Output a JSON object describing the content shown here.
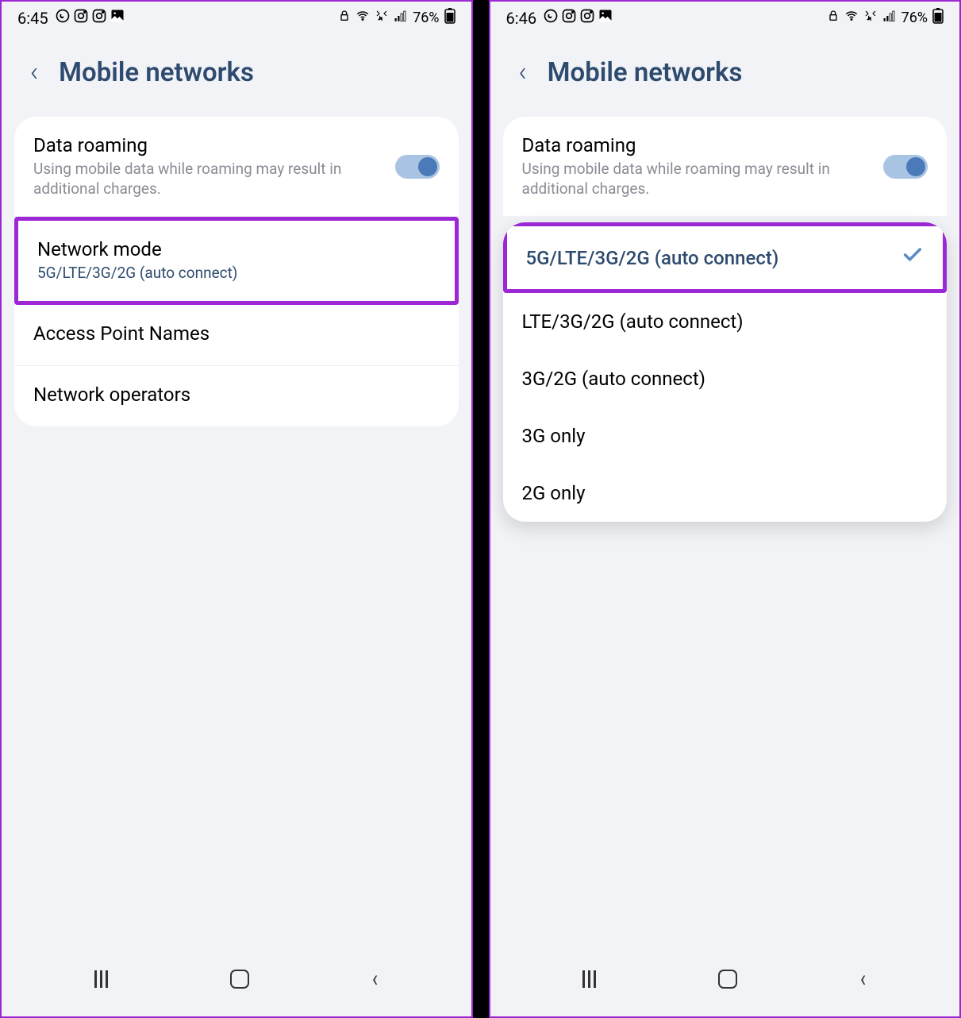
{
  "left": {
    "status": {
      "time": "6:45",
      "battery": "76%"
    },
    "header": {
      "title": "Mobile networks"
    },
    "rows": {
      "roaming": {
        "title": "Data roaming",
        "subtitle": "Using mobile data while roaming may result in additional charges."
      },
      "network_mode": {
        "title": "Network mode",
        "subtitle": "5G/LTE/3G/2G (auto connect)"
      },
      "apn": {
        "title": "Access Point Names"
      },
      "operators": {
        "title": "Network operators"
      }
    }
  },
  "right": {
    "status": {
      "time": "6:46",
      "battery": "76%"
    },
    "header": {
      "title": "Mobile networks"
    },
    "rows": {
      "roaming": {
        "title": "Data roaming",
        "subtitle": "Using mobile data while roaming may result in additional charges."
      }
    },
    "dropdown": {
      "selected": "5G/LTE/3G/2G (auto connect)",
      "options": {
        "o1": "LTE/3G/2G (auto connect)",
        "o2": "3G/2G (auto connect)",
        "o3": "3G only",
        "o4": "2G only"
      }
    }
  }
}
